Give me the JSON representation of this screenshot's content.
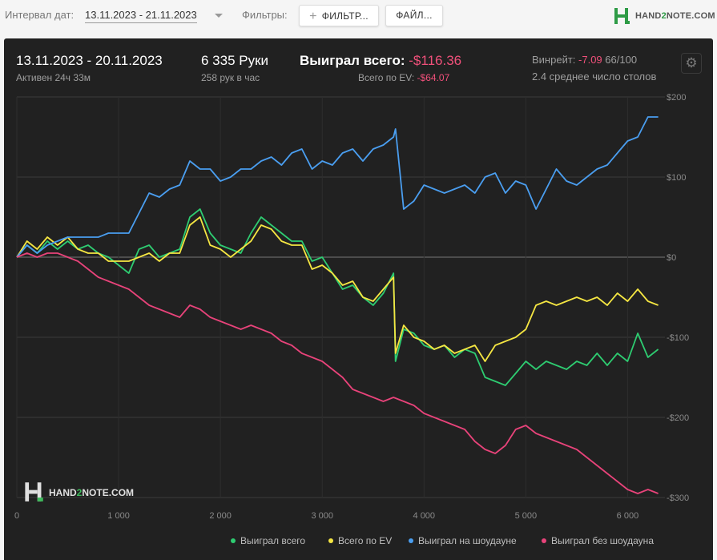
{
  "toolbar": {
    "date_label": "Интервал дат:",
    "date_range": "13.11.2023 - 21.11.2023",
    "filters_label": "Фильтры:",
    "filter_button": "ФИЛЬТР...",
    "files_button": "ФАЙЛ...",
    "logo_pre": "HAND",
    "logo_num": "2",
    "logo_post": "NOTE.COM"
  },
  "summary": {
    "period": "13.11.2023 - 20.11.2023",
    "active": "Активен 24ч 33м",
    "hands": "6 335 Руки",
    "hands_per_hour": "258 рук в час",
    "won_label": "Выиграл всего:",
    "won_value": "-$116.36",
    "ev_label": "Всего по EV:",
    "ev_value": "-$64.07",
    "winrate_label": "Винрейт:",
    "winrate_value": "-7.09",
    "winrate_of": "66/100",
    "tables": "2.4 среднее число столов"
  },
  "watermark": {
    "pre": "HAND",
    "num": "2",
    "post": "NOTE.COM"
  },
  "chart_data": {
    "type": "line",
    "xlabel": "",
    "ylabel": "",
    "xlim": [
      0,
      6335
    ],
    "ylim": [
      -300,
      200
    ],
    "x_ticks": [
      0,
      1000,
      2000,
      3000,
      4000,
      5000,
      6000
    ],
    "x_tick_labels": [
      "0",
      "1 000",
      "2 000",
      "3 000",
      "4 000",
      "5 000",
      "6 000"
    ],
    "y_ticks": [
      200,
      100,
      0,
      -100,
      -200,
      -300
    ],
    "y_tick_labels": [
      "$200",
      "$100",
      "$0",
      "-$100",
      "-$200",
      "-$300"
    ],
    "grid": true,
    "legend_position": "bottom-right",
    "series": [
      {
        "name": "Выиграл всего",
        "color": "#2ecc71",
        "x": [
          0,
          100,
          200,
          300,
          400,
          500,
          600,
          700,
          800,
          900,
          1000,
          1100,
          1200,
          1300,
          1400,
          1500,
          1600,
          1700,
          1800,
          1900,
          2000,
          2100,
          2200,
          2300,
          2400,
          2500,
          2600,
          2700,
          2800,
          2900,
          3000,
          3100,
          3200,
          3300,
          3400,
          3500,
          3600,
          3700,
          3720,
          3800,
          3900,
          4000,
          4100,
          4200,
          4300,
          4400,
          4500,
          4600,
          4700,
          4800,
          4900,
          5000,
          5100,
          5200,
          5300,
          5400,
          5500,
          5600,
          5700,
          5800,
          5900,
          6000,
          6100,
          6200,
          6300
        ],
        "values": [
          0,
          15,
          5,
          20,
          10,
          20,
          10,
          15,
          5,
          0,
          -10,
          -20,
          10,
          15,
          0,
          5,
          10,
          50,
          60,
          30,
          15,
          10,
          5,
          30,
          50,
          40,
          30,
          20,
          20,
          -5,
          0,
          -20,
          -40,
          -35,
          -50,
          -60,
          -45,
          -20,
          -130,
          -90,
          -95,
          -110,
          -115,
          -110,
          -125,
          -115,
          -120,
          -150,
          -155,
          -160,
          -145,
          -130,
          -140,
          -130,
          -135,
          -140,
          -130,
          -135,
          -120,
          -135,
          -120,
          -130,
          -95,
          -125,
          -115
        ]
      },
      {
        "name": "Всего по EV",
        "color": "#f5e642",
        "x": [
          0,
          100,
          200,
          300,
          400,
          500,
          600,
          700,
          800,
          900,
          1000,
          1100,
          1200,
          1300,
          1400,
          1500,
          1600,
          1700,
          1800,
          1900,
          2000,
          2100,
          2200,
          2300,
          2400,
          2500,
          2600,
          2700,
          2800,
          2900,
          3000,
          3100,
          3200,
          3300,
          3400,
          3500,
          3600,
          3700,
          3720,
          3800,
          3900,
          4000,
          4100,
          4200,
          4300,
          4400,
          4500,
          4600,
          4700,
          4800,
          4900,
          5000,
          5100,
          5200,
          5300,
          5400,
          5500,
          5600,
          5700,
          5800,
          5900,
          6000,
          6100,
          6200,
          6300
        ],
        "values": [
          0,
          20,
          10,
          25,
          15,
          25,
          10,
          5,
          5,
          -5,
          -5,
          -5,
          0,
          5,
          -5,
          5,
          5,
          40,
          50,
          15,
          10,
          0,
          10,
          20,
          40,
          35,
          20,
          15,
          15,
          -15,
          -10,
          -20,
          -35,
          -30,
          -50,
          -55,
          -40,
          -25,
          -120,
          -85,
          -100,
          -105,
          -115,
          -110,
          -120,
          -115,
          -110,
          -130,
          -110,
          -105,
          -100,
          -90,
          -60,
          -55,
          -60,
          -55,
          -50,
          -55,
          -50,
          -60,
          -45,
          -55,
          -40,
          -55,
          -60
        ]
      },
      {
        "name": "Выиграл на шоудауне",
        "color": "#4a9ef0",
        "x": [
          0,
          100,
          200,
          300,
          400,
          500,
          600,
          700,
          800,
          900,
          1000,
          1100,
          1200,
          1300,
          1400,
          1500,
          1600,
          1700,
          1800,
          1900,
          2000,
          2100,
          2200,
          2300,
          2400,
          2500,
          2600,
          2700,
          2800,
          2900,
          3000,
          3100,
          3200,
          3300,
          3400,
          3500,
          3600,
          3700,
          3720,
          3800,
          3900,
          4000,
          4100,
          4200,
          4300,
          4400,
          4500,
          4600,
          4700,
          4800,
          4900,
          5000,
          5100,
          5200,
          5300,
          5400,
          5500,
          5600,
          5700,
          5800,
          5900,
          6000,
          6100,
          6200,
          6300
        ],
        "values": [
          0,
          15,
          5,
          15,
          20,
          25,
          25,
          25,
          25,
          30,
          30,
          30,
          55,
          80,
          75,
          85,
          90,
          120,
          110,
          110,
          95,
          100,
          110,
          110,
          120,
          125,
          115,
          130,
          135,
          110,
          120,
          115,
          130,
          135,
          120,
          135,
          140,
          150,
          160,
          60,
          70,
          90,
          85,
          80,
          85,
          90,
          80,
          100,
          105,
          80,
          95,
          90,
          60,
          85,
          110,
          95,
          90,
          100,
          110,
          115,
          130,
          145,
          150,
          175,
          175
        ]
      },
      {
        "name": "Выиграл без шоудауна",
        "color": "#e8437a",
        "x": [
          0,
          100,
          200,
          300,
          400,
          500,
          600,
          700,
          800,
          900,
          1000,
          1100,
          1200,
          1300,
          1400,
          1500,
          1600,
          1700,
          1800,
          1900,
          2000,
          2100,
          2200,
          2300,
          2400,
          2500,
          2600,
          2700,
          2800,
          2900,
          3000,
          3100,
          3200,
          3300,
          3400,
          3500,
          3600,
          3700,
          3800,
          3900,
          4000,
          4100,
          4200,
          4300,
          4400,
          4500,
          4600,
          4700,
          4800,
          4900,
          5000,
          5100,
          5200,
          5300,
          5400,
          5500,
          5600,
          5700,
          5800,
          5900,
          6000,
          6100,
          6200,
          6300
        ],
        "values": [
          0,
          5,
          0,
          5,
          5,
          0,
          -5,
          -15,
          -25,
          -30,
          -35,
          -40,
          -50,
          -60,
          -65,
          -70,
          -75,
          -60,
          -65,
          -75,
          -80,
          -85,
          -90,
          -85,
          -90,
          -95,
          -105,
          -110,
          -120,
          -125,
          -130,
          -140,
          -150,
          -165,
          -170,
          -175,
          -180,
          -175,
          -180,
          -185,
          -195,
          -200,
          -205,
          -210,
          -215,
          -230,
          -240,
          -245,
          -235,
          -215,
          -210,
          -220,
          -225,
          -230,
          -235,
          -240,
          -250,
          -260,
          -270,
          -280,
          -290,
          -295,
          -290,
          -295
        ]
      }
    ]
  }
}
